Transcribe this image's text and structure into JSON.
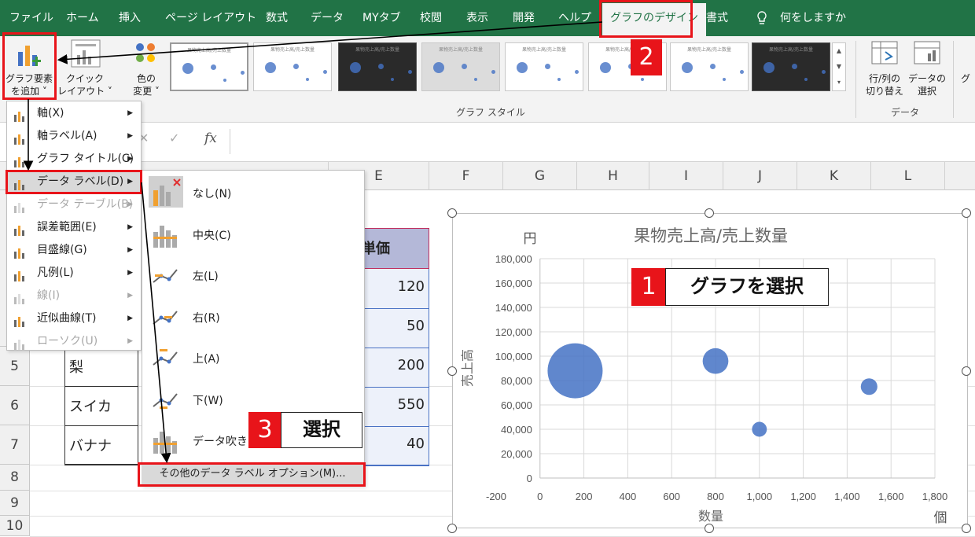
{
  "tabs": [
    {
      "label": "ファイル",
      "x": 12
    },
    {
      "label": "ホーム",
      "x": 84
    },
    {
      "label": "挿入",
      "x": 151
    },
    {
      "label": "ページ レイアウト",
      "x": 210
    },
    {
      "label": "数式",
      "x": 338
    },
    {
      "label": "データ",
      "x": 395
    },
    {
      "label": "MYタブ",
      "x": 461
    },
    {
      "label": "校閲",
      "x": 534
    },
    {
      "label": "表示",
      "x": 593
    },
    {
      "label": "開発",
      "x": 652
    },
    {
      "label": "ヘルプ",
      "x": 710
    }
  ],
  "active_tab": "グラフのデザイン",
  "tab_format": "書式",
  "tell_me": "何をしますか",
  "ribbon": {
    "add_element": [
      "グラフ要素",
      "を追加 ˅"
    ],
    "quick_layout": [
      "クイック",
      "レイアウト ˅"
    ],
    "change_color": [
      "色の",
      "変更 ˅"
    ],
    "chart_styles_label": "グラフ スタイル",
    "switch_row_col": [
      "行/列の",
      "切り替え"
    ],
    "select_data": [
      "データの",
      "選択"
    ],
    "data_group_label": "データ",
    "next_group": "グ",
    "thumb_title": "果物売上高/売上数量"
  },
  "formula": {
    "fx": "fx"
  },
  "columns": [
    "E",
    "F",
    "G",
    "H",
    "I",
    "J",
    "K",
    "L"
  ],
  "rows": [
    "5",
    "6",
    "7",
    "8",
    "9",
    "10"
  ],
  "cells": {
    "header_unit_price": "単価",
    "fruits": [
      "梨",
      "スイカ",
      "バナナ"
    ],
    "prices": [
      "120",
      "50",
      "200",
      "550",
      "40"
    ]
  },
  "menu1": [
    {
      "label": "軸(X)",
      "u": "X",
      "disabled": false
    },
    {
      "label": "軸ラベル(A)",
      "disabled": false
    },
    {
      "label": "グラフ タイトル(C)",
      "disabled": false
    },
    {
      "label": "データ ラベル(D)",
      "disabled": false,
      "selected": true
    },
    {
      "label": "データ テーブル(B)",
      "disabled": true
    },
    {
      "label": "誤差範囲(E)",
      "disabled": false
    },
    {
      "label": "目盛線(G)",
      "disabled": false
    },
    {
      "label": "凡例(L)",
      "disabled": false
    },
    {
      "label": "線(I)",
      "disabled": true
    },
    {
      "label": "近似曲線(T)",
      "disabled": false
    },
    {
      "label": "ローソク(U)",
      "disabled": true
    }
  ],
  "menu2": [
    {
      "label": "なし(N)"
    },
    {
      "label": "中央(C)"
    },
    {
      "label": "左(L)"
    },
    {
      "label": "右(R)"
    },
    {
      "label": "上(A)"
    },
    {
      "label": "下(W)"
    },
    {
      "label": "データ吹き出し"
    }
  ],
  "menu2_more": "その他のデータ ラベル オプション(M)...",
  "annotations": {
    "n1": "1",
    "t1": "グラフを選択",
    "n2": "2",
    "n3": "3",
    "t3": "選択"
  },
  "chart_data": {
    "type": "scatter",
    "title": "果物売上高/売上数量",
    "xlabel": "数量",
    "ylabel": "売上高",
    "y_unit": "円",
    "x_unit": "個",
    "xlim": [
      -200,
      1800
    ],
    "ylim": [
      0,
      180000
    ],
    "xticks": [
      "-200",
      "0",
      "200",
      "400",
      "600",
      "800",
      "1,000",
      "1,200",
      "1,400",
      "1,600",
      "1,800"
    ],
    "yticks": [
      "0",
      "20,000",
      "40,000",
      "60,000",
      "80,000",
      "100,000",
      "120,000",
      "140,000",
      "160,000",
      "180,000"
    ],
    "bubble_color": "#4472c4",
    "points": [
      {
        "x": 160,
        "y": 88000,
        "size": 550
      },
      {
        "x": 800,
        "y": 96000,
        "size": 120
      },
      {
        "x": 1000,
        "y": 40000,
        "size": 40
      },
      {
        "x": 1500,
        "y": 75000,
        "size": 50
      }
    ]
  },
  "colors": {
    "excel_green": "#217346",
    "accent_red": "#e8141a",
    "bubble": "#4472c4"
  }
}
